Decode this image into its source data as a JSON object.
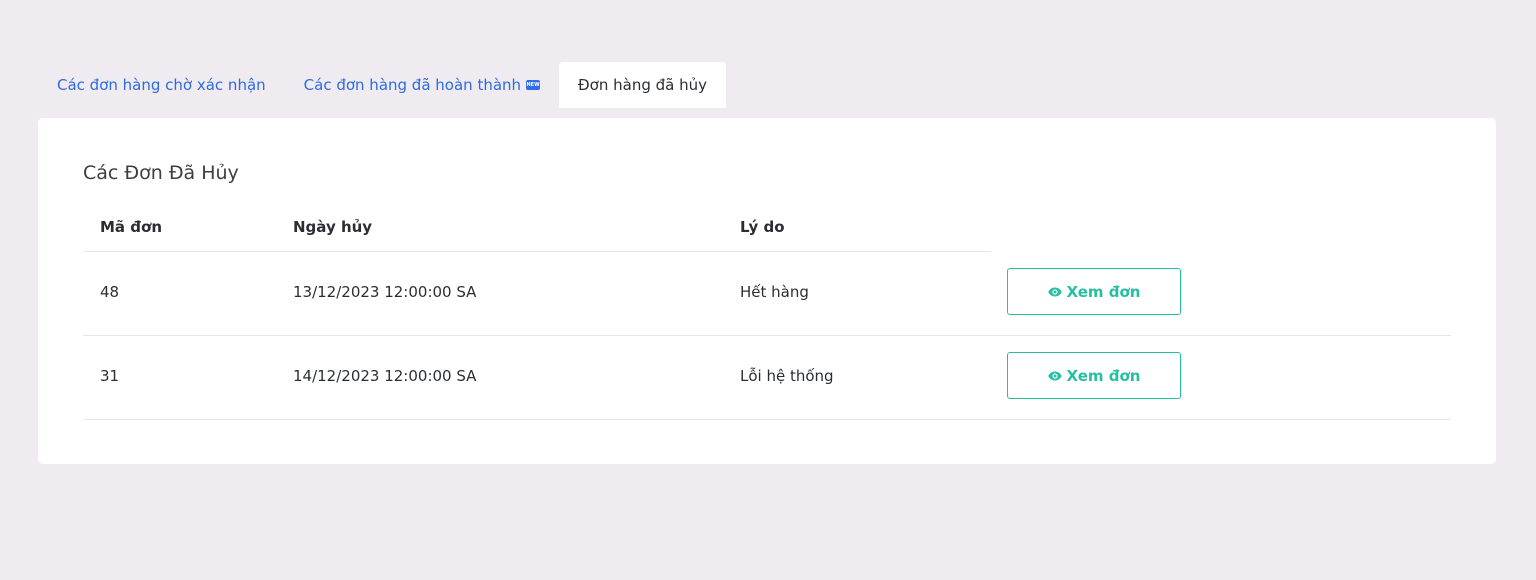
{
  "tabs": [
    {
      "label": "Các đơn hàng chờ xác nhận",
      "active": false
    },
    {
      "label": "Các đơn hàng đã hoàn thành",
      "active": false,
      "badge": "NEW"
    },
    {
      "label": "Đơn hàng đã hủy",
      "active": true
    }
  ],
  "card": {
    "title": "Các Đơn Đã Hủy"
  },
  "table": {
    "headers": {
      "id": "Mã đơn",
      "date": "Ngày hủy",
      "reason": "Lý do"
    },
    "rows": [
      {
        "id": "48",
        "date": "13/12/2023 12:00:00 SA",
        "reason": "Hết hàng",
        "action": "Xem đơn"
      },
      {
        "id": "31",
        "date": "14/12/2023 12:00:00 SA",
        "reason": "Lỗi hệ thống",
        "action": "Xem đơn"
      }
    ]
  },
  "colors": {
    "background": "#f0ebf1",
    "link": "#2d6be0",
    "accent": "#27bfa2",
    "badge": "#2f6fe6"
  },
  "icons": {
    "new_badge": "new-badge-icon",
    "view": "eye-icon"
  }
}
